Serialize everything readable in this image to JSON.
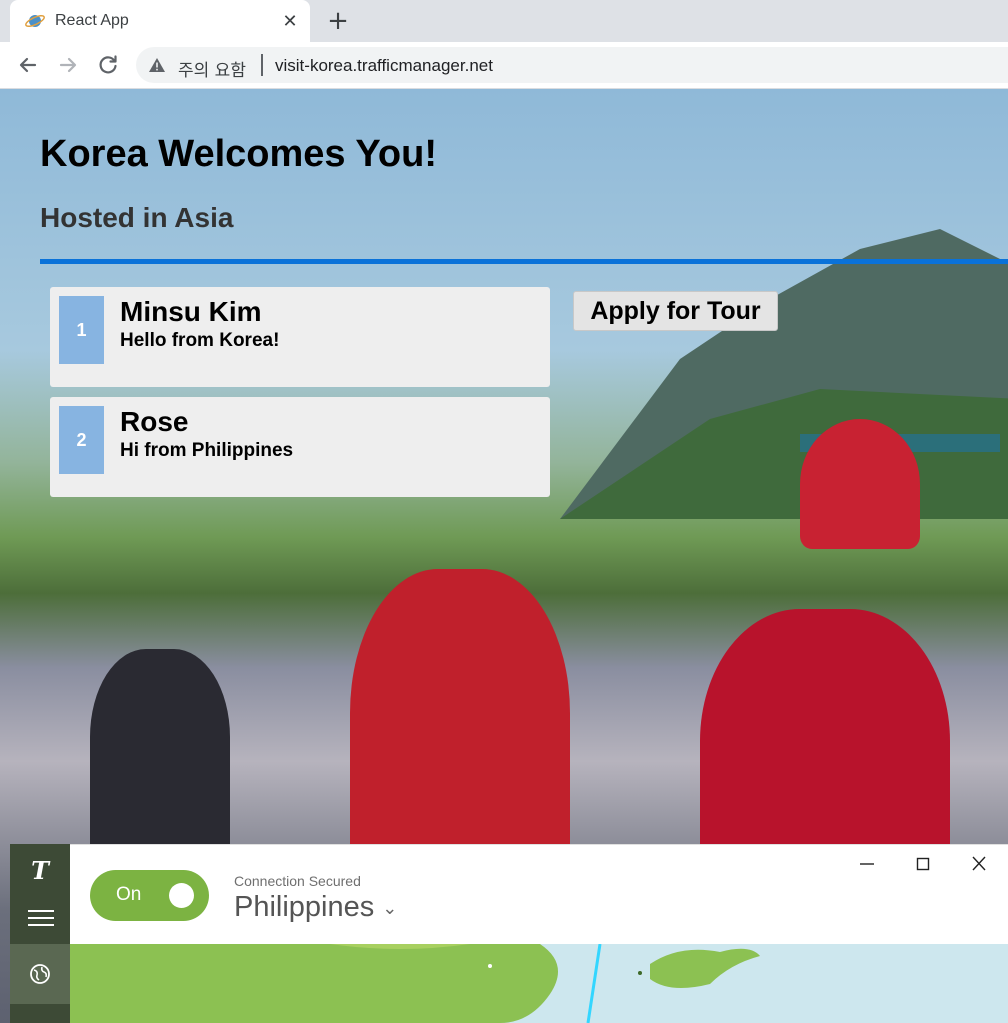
{
  "browser": {
    "tab_title": "React App",
    "tab_close": "✕",
    "new_tab": "+",
    "security_warning": "주의 요함",
    "url": "visit-korea.trafficmanager.net"
  },
  "page": {
    "title": "Korea Welcomes You!",
    "subtitle": "Hosted in Asia",
    "apply_button": "Apply for Tour",
    "entries": [
      {
        "number": "1",
        "name": "Minsu Kim",
        "message": "Hello from Korea!"
      },
      {
        "number": "2",
        "name": "Rose",
        "message": "Hi from Philippines"
      }
    ]
  },
  "vpn": {
    "toggle_label": "On",
    "status": "Connection Secured",
    "country": "Philippines",
    "colors": {
      "sidebar": "#3d4a36",
      "toggle": "#7cb342"
    }
  },
  "colors": {
    "accent_rule": "#0a72d9",
    "card_number_bg": "#87b4e1"
  }
}
